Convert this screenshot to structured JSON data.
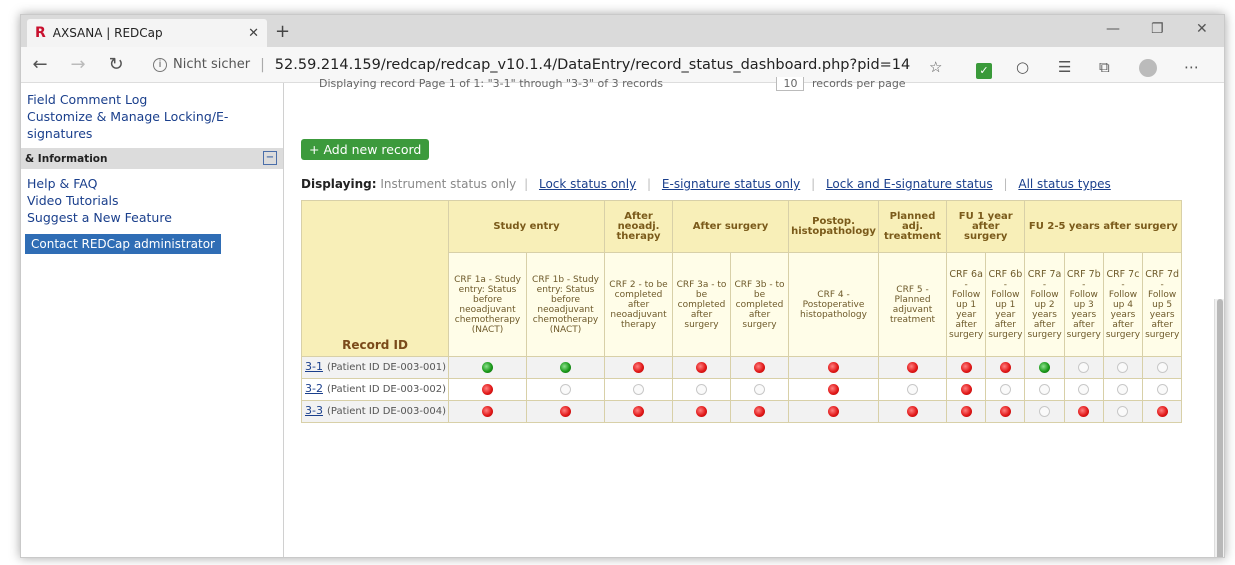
{
  "browser": {
    "tab_title": "AXSANA | REDCap",
    "new_tab": "+",
    "insecure_label": "Nicht sicher",
    "url": "52.59.214.159/redcap/redcap_v10.1.4/DataEntry/record_status_dashboard.php?pid=14",
    "icons": [
      "back-icon",
      "forward-icon",
      "refresh-icon",
      "info-icon",
      "star-icon",
      "extension-icon",
      "vpn-icon",
      "favorites-icon",
      "collections-icon",
      "profile-icon",
      "more-icon"
    ]
  },
  "sidebar": {
    "links_top": [
      "Field Comment Log",
      "Customize & Manage Locking/E-signatures"
    ],
    "section_title": "& Information",
    "links_bottom": [
      "Help & FAQ",
      "Video Tutorials",
      "Suggest a New Feature"
    ],
    "contact_button": "Contact REDCap administrator"
  },
  "main": {
    "paging_text": "Displaying record  Page 1 of 1: \"3-1\" through \"3-3\"  of 3 records",
    "per_page": "10",
    "per_page_suffix": "records per page",
    "add_record": "Add new record",
    "displaying_label": "Displaying:",
    "display_current": "Instrument status only",
    "display_links": [
      "Lock status only",
      "E-signature status only",
      "Lock and E-signature status",
      "All status types"
    ],
    "record_id_header": "Record ID"
  },
  "dashboard": {
    "groups": [
      {
        "label": "Study entry",
        "span": 2
      },
      {
        "label": "After neoadj. therapy",
        "span": 1
      },
      {
        "label": "After surgery",
        "span": 2
      },
      {
        "label": "Postop. histopathology",
        "span": 1
      },
      {
        "label": "Planned adj. treatment",
        "span": 1
      },
      {
        "label": "FU 1 year after surgery",
        "span": 2
      },
      {
        "label": "FU 2-5 years after surgery",
        "span": 4
      }
    ],
    "instruments": [
      {
        "code": "",
        "text": "CRF 1a - Study entry: Status before neoadjuvant chemotherapy (NACT)"
      },
      {
        "code": "",
        "text": "CRF 1b - Study entry: Status before neoadjuvant chemotherapy (NACT)"
      },
      {
        "code": "",
        "text": "CRF 2 - to be completed after neoadjuvant therapy"
      },
      {
        "code": "",
        "text": "CRF 3a - to be completed after surgery"
      },
      {
        "code": "",
        "text": "CRF 3b - to be completed after surgery"
      },
      {
        "code": "",
        "text": "CRF 4 - Postoperative histopathology"
      },
      {
        "code": "",
        "text": "CRF 5 - Planned adjuvant treatment"
      },
      {
        "code": "CRF 6a",
        "text": "- Follow up 1 year after surgery"
      },
      {
        "code": "CRF 6b",
        "text": "- Follow up 1 year after surgery"
      },
      {
        "code": "CRF 7a",
        "text": "- Follow up 2 years after surgery"
      },
      {
        "code": "CRF 7b",
        "text": "- Follow up 3 years after surgery"
      },
      {
        "code": "CRF 7c",
        "text": "- Follow up 4 years after surgery"
      },
      {
        "code": "CRF 7d",
        "text": "- Follow up 5 years after surgery"
      }
    ],
    "records": [
      {
        "id": "3-1",
        "patient": "(Patient ID DE-003-001)",
        "status": [
          "green",
          "green",
          "red",
          "red",
          "red",
          "red",
          "red",
          "red",
          "red",
          "green",
          "gray",
          "gray",
          "gray"
        ]
      },
      {
        "id": "3-2",
        "patient": "(Patient ID DE-003-002)",
        "status": [
          "red",
          "gray",
          "gray",
          "gray",
          "gray",
          "red",
          "gray",
          "red",
          "gray",
          "gray",
          "gray",
          "gray",
          "gray"
        ]
      },
      {
        "id": "3-3",
        "patient": "(Patient ID DE-003-004)",
        "status": [
          "red",
          "red",
          "red",
          "red",
          "red",
          "red",
          "red",
          "red",
          "red",
          "gray",
          "red",
          "gray",
          "red"
        ]
      }
    ],
    "status_colors": {
      "red": "#e21a1a",
      "green": "#1b9a1b",
      "gray": "#fafafa"
    }
  }
}
